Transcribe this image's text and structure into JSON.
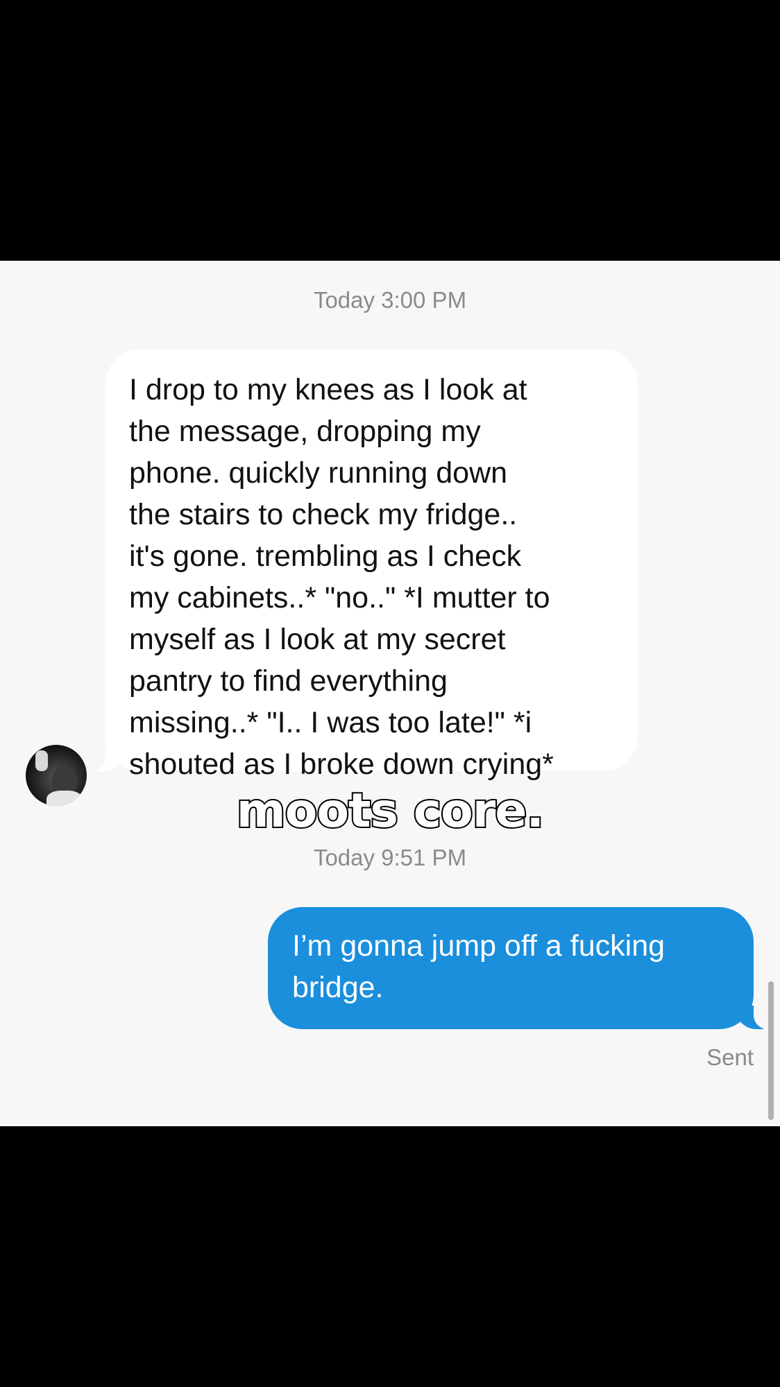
{
  "conversation": {
    "timestamps": [
      "Today 3:00 PM",
      "Today 9:51 PM"
    ],
    "received_message": {
      "text": "I drop to my knees as I look at\nthe message, dropping my\nphone. quickly running down\nthe stairs to check my fridge..\nit's gone. trembling as I check\nmy cabinets..* \"no..\" *I mutter to\nmyself as I look at my secret\npantry to find everything\nmissing..* \"I.. I was too late!\" *i\nshouted as I broke down crying*"
    },
    "sent_message": {
      "text": "I’m gonna jump off a fucking\nbridge.",
      "status": "Sent"
    }
  },
  "overlay": {
    "caption": "moots core."
  },
  "colors": {
    "sent_bubble": "#1b8fdc",
    "received_bubble": "#ffffff",
    "chat_background": "#f7f7f7",
    "letterbox": "#000000",
    "timestamp_text": "#8a8a8e"
  },
  "icons": {
    "avatar": "contact-photo"
  }
}
